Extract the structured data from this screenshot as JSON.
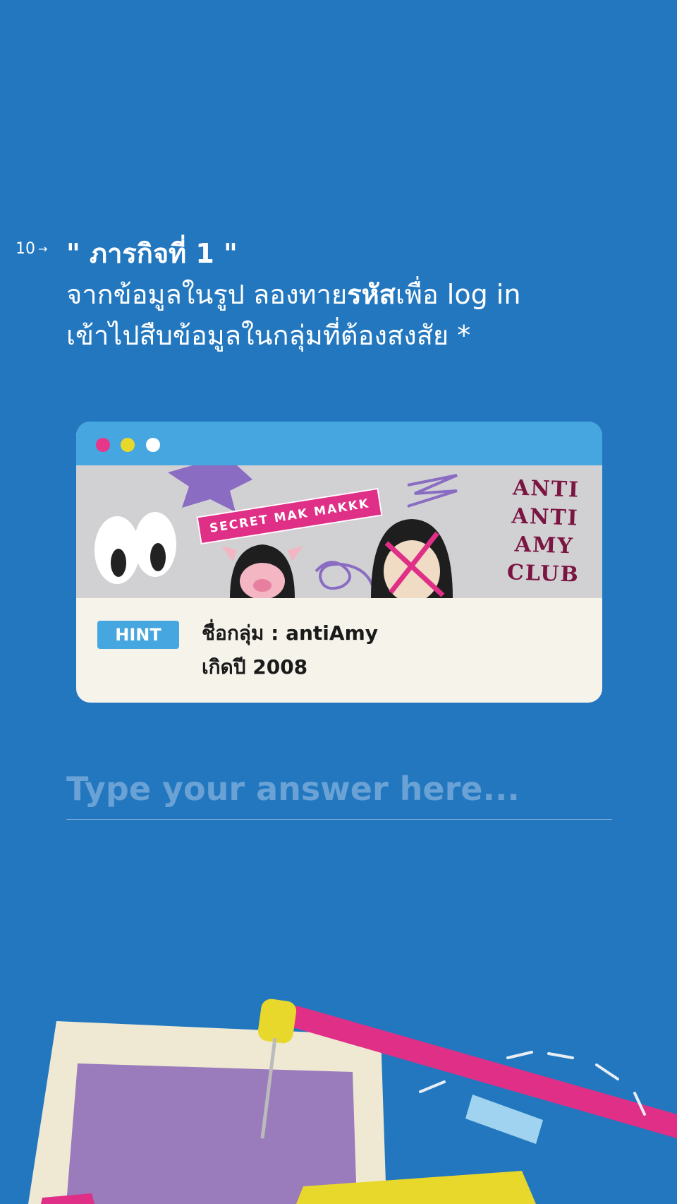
{
  "question": {
    "number": "10",
    "title": "\" ภารกิจที่ 1 \"",
    "line1_prefix": "จากข้อมูลในรูป ลองทาย",
    "line1_bold": "รหัส",
    "line1_suffix": "เพื่อ log in",
    "line2": "เข้าไปสืบข้อมูลในกลุ่มที่ต้องสงสัย *"
  },
  "card": {
    "secret_tag": "SECRET MAK MAKKK",
    "club_lines": [
      "ANTI",
      "ANTI",
      "AMY",
      "CLUB"
    ],
    "hint_label": "HINT",
    "hint_line1": "ชื่อกลุ่ม : antiAmy",
    "hint_line2": "เกิดปี 2008"
  },
  "answer": {
    "placeholder": "Type your answer here..."
  },
  "colors": {
    "background": "#2277bf",
    "accent_pink": "#e02f86",
    "accent_blue": "#45a6e0",
    "accent_yellow": "#e9d82c"
  }
}
